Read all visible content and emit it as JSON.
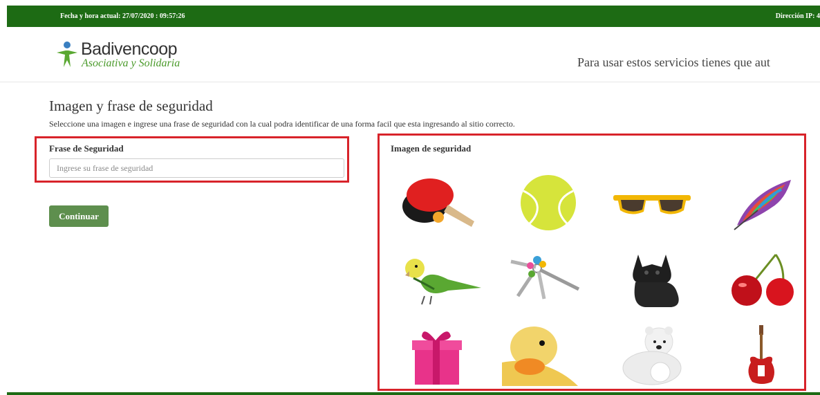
{
  "topbar": {
    "datetime": "Fecha y hora actual: 27/07/2020 : 09:57:26",
    "ip_label": "Dirección IP: 4"
  },
  "logo": {
    "name": "Badivencoop",
    "tagline": "Asociativa y Solidaria"
  },
  "header": {
    "auth_notice": "Para usar estos servicios tienes que aut"
  },
  "page": {
    "title": "Imagen y frase de seguridad",
    "subtitle": "Seleccione una imagen e ingrese una frase de seguridad con la cual podra identificar de una forma facil que esta ingresando al sitio correcto."
  },
  "phrase": {
    "label": "Frase de Seguridad",
    "placeholder": "Ingrese su frase de seguridad",
    "value": ""
  },
  "continue_label": "Continuar",
  "security_images": {
    "label": "Imagen de seguridad",
    "images": [
      "ping-pong-paddle",
      "tennis-ball",
      "sunglasses",
      "feather",
      "parakeet",
      "keys",
      "french-bulldog",
      "cherries",
      "gift-box",
      "duckling",
      "polar-bear-cub",
      "electric-guitar"
    ]
  },
  "colors": {
    "topbar": "#1d6b14",
    "button": "#5e8f4e",
    "highlight": "#d8232a",
    "tagline": "#4a9a2a"
  }
}
